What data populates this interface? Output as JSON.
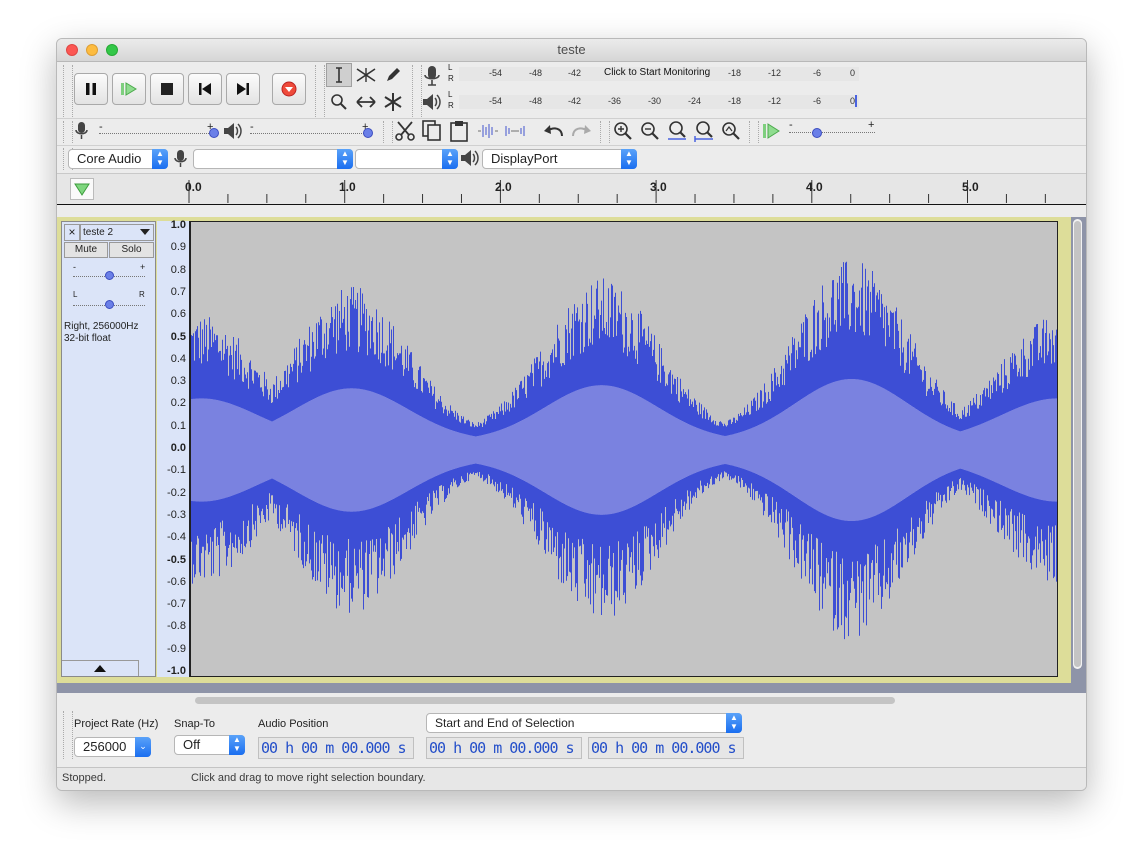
{
  "window": {
    "title": "teste"
  },
  "transport": {
    "buttons": [
      "pause",
      "play",
      "stop",
      "skip-start",
      "skip-end",
      "record"
    ]
  },
  "meters": {
    "record": {
      "channels": [
        "L",
        "R"
      ],
      "ticks": [
        "-54",
        "-48",
        "-42",
        "-18",
        "-12",
        "-6",
        "0"
      ],
      "prompt": "Click to Start Monitoring"
    },
    "playback": {
      "channels": [
        "L",
        "R"
      ],
      "ticks": [
        "-54",
        "-48",
        "-42",
        "-36",
        "-30",
        "-24",
        "-18",
        "-12",
        "-6",
        "0"
      ]
    }
  },
  "mixer": {
    "rec_minus": "-",
    "rec_plus": "+",
    "play_minus": "-",
    "play_plus": "+",
    "speed_minus": "-",
    "speed_plus": "+"
  },
  "devices": {
    "host": "Core Audio",
    "input": "",
    "channels": "",
    "output": "DisplayPort"
  },
  "timeline": {
    "ticks": [
      "0.0",
      "1.0",
      "2.0",
      "3.0",
      "4.0",
      "5.0"
    ]
  },
  "track": {
    "name": "teste 2",
    "mute": "Mute",
    "solo": "Solo",
    "gain_minus": "-",
    "gain_plus": "+",
    "pan_left": "L",
    "pan_right": "R",
    "info_line1": "Right, 256000Hz",
    "info_line2": "32-bit float",
    "scale": [
      "1.0",
      "0.9",
      "0.8",
      "0.7",
      "0.6",
      "0.5",
      "0.4",
      "0.3",
      "0.2",
      "0.1",
      "0.0",
      "-0.1",
      "-0.2",
      "-0.3",
      "-0.4",
      "-0.5",
      "-0.6",
      "-0.7",
      "-0.8",
      "-0.9",
      "-1.0"
    ],
    "wave_color": "#3d4ed5",
    "rms_color": "#7a82e0"
  },
  "selection_bar": {
    "project_rate_label": "Project Rate (Hz)",
    "project_rate_value": "256000",
    "snap_to_label": "Snap-To",
    "snap_to_value": "Off",
    "audio_position_label": "Audio Position",
    "audio_position_value": "00 h 00 m 00.000 s",
    "selection_mode": "Start and End of Selection",
    "selection_start": "00 h 00 m 00.000 s",
    "selection_end": "00 h 00 m 00.000 s"
  },
  "status": {
    "state": "Stopped.",
    "hint": "Click and drag to move right selection boundary."
  }
}
